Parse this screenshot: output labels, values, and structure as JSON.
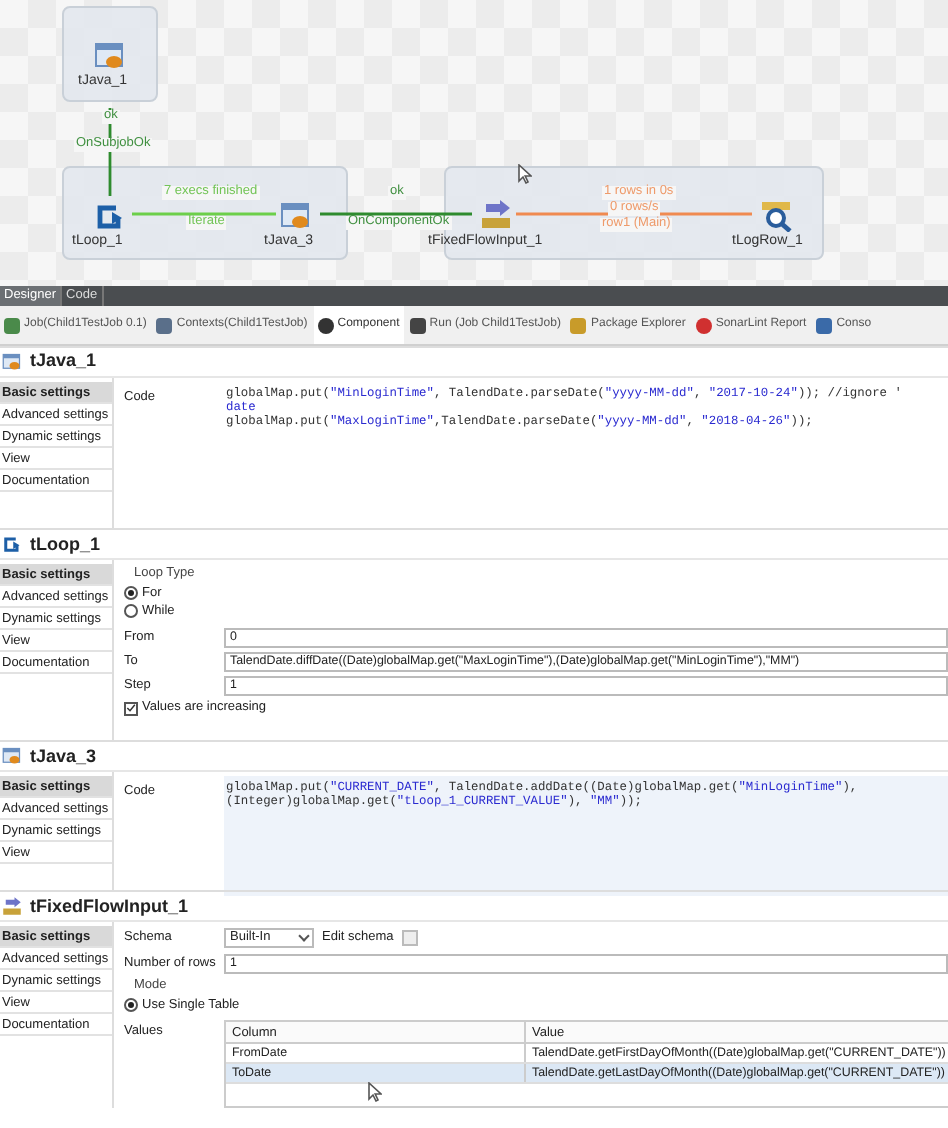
{
  "canvas": {
    "nodes": [
      {
        "label": "tJava_1",
        "kind": "java"
      },
      {
        "label": "tLoop_1",
        "kind": "loop"
      },
      {
        "label": "tJava_3",
        "kind": "java"
      },
      {
        "label": "tFixedFlowInput_1",
        "kind": "fixed_flow"
      },
      {
        "label": "tLogRow_1",
        "kind": "log_row"
      }
    ],
    "links": [
      {
        "kind": "trigger",
        "labels": [
          "ok",
          "OnSubjobOk"
        ]
      },
      {
        "kind": "iterate",
        "labels": [
          "7 execs finished",
          "Iterate"
        ]
      },
      {
        "kind": "trigger",
        "labels": [
          "ok",
          "OnComponentOk"
        ]
      },
      {
        "kind": "main",
        "labels": [
          "1 rows in 0s",
          "0 rows/s",
          "row1 (Main)"
        ]
      }
    ]
  },
  "editor_tabs": [
    {
      "label": "Designer",
      "selected": true
    },
    {
      "label": "Code",
      "selected": false
    }
  ],
  "view_tabs": [
    {
      "label": "Job(Child1TestJob 0.1)",
      "selected": false
    },
    {
      "label": "Contexts(Child1TestJob)",
      "selected": false
    },
    {
      "label": "Component",
      "selected": true
    },
    {
      "label": "Run (Job Child1TestJob)",
      "selected": false
    },
    {
      "label": "Package Explorer",
      "selected": false
    },
    {
      "label": "SonarLint Report",
      "selected": false
    },
    {
      "label": "Conso",
      "selected": false
    }
  ],
  "panels": [
    {
      "title": "tJava_1",
      "kind": "java",
      "settings": [
        {
          "label": "Basic settings",
          "selected": true
        },
        {
          "label": "Advanced settings",
          "selected": false
        },
        {
          "label": "Dynamic settings",
          "selected": false
        },
        {
          "label": "View",
          "selected": false
        },
        {
          "label": "Documentation",
          "selected": false
        }
      ],
      "fields": [
        {
          "kind": "code",
          "label": "Code",
          "lines": [
            "globalMap.put(\"MinLoginTime\", TalendDate.parseDate(\"yyyy-MM-dd\", \"2017-10-24\")); //ignore '",
            "date",
            "globalMap.put(\"MaxLoginTime\",TalendDate.parseDate(\"yyyy-MM-dd\", \"2018-04-26\"));"
          ]
        }
      ]
    },
    {
      "title": "tLoop_1",
      "kind": "loop",
      "settings": [
        {
          "label": "Basic settings",
          "selected": true
        },
        {
          "label": "Advanced settings",
          "selected": false
        },
        {
          "label": "Dynamic settings",
          "selected": false
        },
        {
          "label": "View",
          "selected": false
        },
        {
          "label": "Documentation",
          "selected": false
        }
      ],
      "fields": [
        {
          "kind": "radio_group",
          "label": "Loop Type",
          "options": [
            {
              "label": "For",
              "selected": true
            },
            {
              "label": "While",
              "selected": false
            }
          ]
        },
        {
          "kind": "text",
          "label": "From",
          "value": "0"
        },
        {
          "kind": "text",
          "label": "To",
          "value": "TalendDate.diffDate((Date)globalMap.get(\"MaxLoginTime\"),(Date)globalMap.get(\"MinLoginTime\"),\"MM\")"
        },
        {
          "kind": "text",
          "label": "Step",
          "value": "1"
        },
        {
          "kind": "checkbox",
          "label": "Values are increasing",
          "checked": true
        }
      ]
    },
    {
      "title": "tJava_3",
      "kind": "java",
      "settings": [
        {
          "label": "Basic settings",
          "selected": true
        },
        {
          "label": "Advanced settings",
          "selected": false
        },
        {
          "label": "Dynamic settings",
          "selected": false
        },
        {
          "label": "View",
          "selected": false
        }
      ],
      "fields": [
        {
          "kind": "code",
          "label": "Code",
          "lines": [
            "globalMap.put(\"CURRENT_DATE\", TalendDate.addDate((Date)globalMap.get(\"MinLoginTime\"),",
            "(Integer)globalMap.get(\"tLoop_1_CURRENT_VALUE\"), \"MM\"));"
          ]
        }
      ]
    },
    {
      "title": "tFixedFlowInput_1",
      "kind": "fixed_flow",
      "settings": [
        {
          "label": "Basic settings",
          "selected": true
        },
        {
          "label": "Advanced settings",
          "selected": false
        },
        {
          "label": "Dynamic settings",
          "selected": false
        },
        {
          "label": "View",
          "selected": false
        },
        {
          "label": "Documentation",
          "selected": false
        }
      ],
      "fields": [
        {
          "kind": "select",
          "label": "Schema",
          "value": "Built-In",
          "extra_label": "Edit schema"
        },
        {
          "kind": "text",
          "label": "Number of rows",
          "value": "1"
        },
        {
          "kind": "radio_group",
          "label": "Mode",
          "options": [
            {
              "label": "Use Single Table",
              "selected": true
            }
          ]
        },
        {
          "kind": "table",
          "label": "Values",
          "columns": [
            "Column",
            "Value"
          ],
          "rows": [
            {
              "cells": [
                "FromDate",
                "TalendDate.getFirstDayOfMonth((Date)globalMap.get(\"CURRENT_DATE\"))"
              ],
              "selected": false
            },
            {
              "cells": [
                "ToDate",
                "TalendDate.getLastDayOfMonth((Date)globalMap.get(\"CURRENT_DATE\"))"
              ],
              "selected": true
            }
          ]
        }
      ]
    }
  ]
}
